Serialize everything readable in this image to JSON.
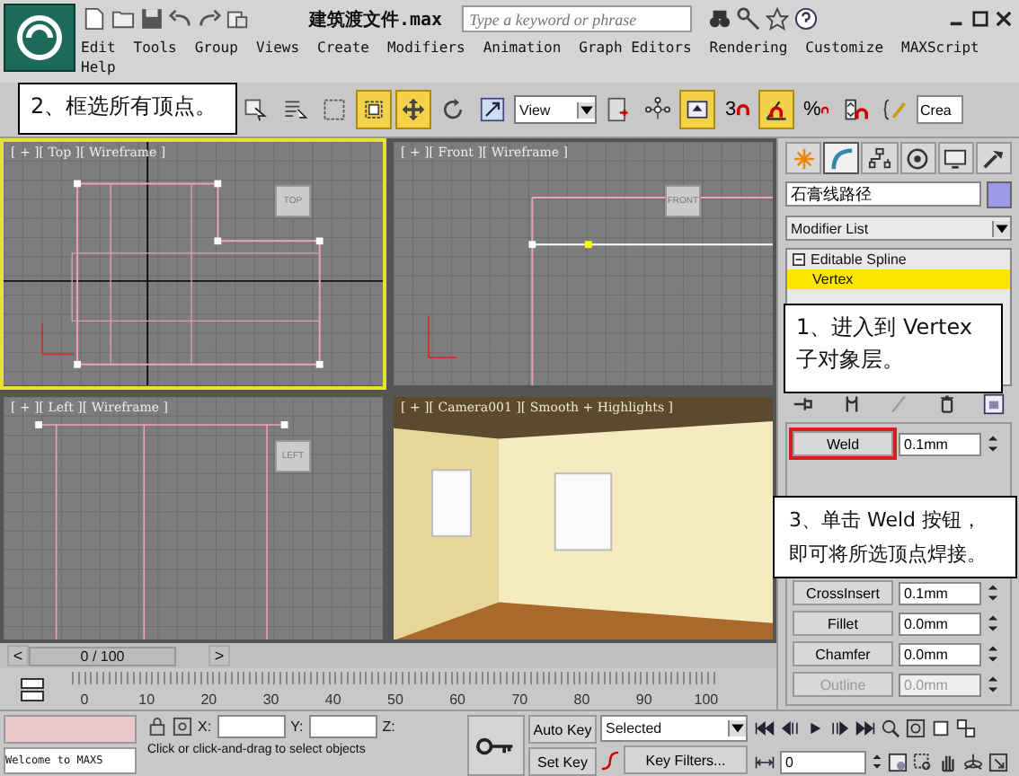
{
  "title_bar": {
    "file_name": "建筑渡文件.max",
    "search": {
      "placeholder": "Type a keyword or phrase"
    }
  },
  "menu": [
    {
      "label": "Edit"
    },
    {
      "label": "Tools"
    },
    {
      "label": "Group"
    },
    {
      "label": "Views"
    },
    {
      "label": "Create"
    },
    {
      "label": "Modifiers"
    },
    {
      "label": "Animation"
    },
    {
      "label": "Graph Editors"
    },
    {
      "label": "Rendering"
    },
    {
      "label": "Customize"
    },
    {
      "label": "MAXScript"
    },
    {
      "label": "Help"
    }
  ],
  "toolbar": {
    "tools": [
      {
        "kind": "select-object",
        "on": false
      },
      {
        "kind": "select-by-name",
        "on": false
      },
      {
        "kind": "region",
        "on": false
      },
      {
        "kind": "window-crossing",
        "on": true
      },
      {
        "kind": "move",
        "on": true
      },
      {
        "kind": "rotate",
        "on": false
      },
      {
        "kind": "scale",
        "on": false
      },
      {
        "kind": "coordinate-dropdown",
        "label": "View"
      },
      {
        "kind": "pivot",
        "on": false
      },
      {
        "kind": "manipulate",
        "on": false
      },
      {
        "kind": "keyboard-toggle",
        "on": true
      },
      {
        "kind": "snap",
        "label": "3",
        "on": false
      },
      {
        "kind": "angle-snap",
        "on": true
      },
      {
        "kind": "percent-snap",
        "label": "%",
        "on": false
      },
      {
        "kind": "spinner-snap",
        "on": false
      },
      {
        "kind": "named-sets",
        "on": false
      },
      {
        "kind": "selection-field",
        "label": "Crea"
      }
    ]
  },
  "viewports": [
    {
      "kind": "top",
      "label": "[ + ][ Top ][ Wireframe ]",
      "cube_label": "TOP",
      "active": true
    },
    {
      "kind": "front",
      "label": "[ + ][ Front ][ Wireframe ]",
      "cube_label": "FRONT",
      "active": false
    },
    {
      "kind": "left",
      "label": "[ + ][ Left ][ Wireframe ]",
      "cube_label": "LEFT",
      "active": false
    },
    {
      "kind": "camera",
      "label": "[ + ][ Camera001 ][ Smooth + Highlights ]",
      "active": false
    }
  ],
  "command_panel": {
    "tabs": [
      {
        "kind": "create",
        "selected": false
      },
      {
        "kind": "modify",
        "selected": true
      },
      {
        "kind": "hierarchy",
        "selected": false
      },
      {
        "kind": "motion",
        "selected": false
      },
      {
        "kind": "display",
        "selected": false
      },
      {
        "kind": "utilities",
        "selected": false
      }
    ],
    "object_name": "石膏线路径",
    "modifier_list": "Modifier List",
    "stack": [
      {
        "label": "Editable Spline",
        "selected": false,
        "children": [
          {
            "label": "Vertex",
            "selected": true
          }
        ]
      }
    ],
    "operations": [
      {
        "label": "Weld",
        "value": "0.1mm",
        "highlighted": true,
        "disabled": false
      },
      {
        "label": "CrossInsert",
        "value": "0.1mm",
        "highlighted": false,
        "disabled": false
      },
      {
        "label": "Fillet",
        "value": "0.0mm",
        "highlighted": false,
        "disabled": false
      },
      {
        "label": "Chamfer",
        "value": "0.0mm",
        "highlighted": false,
        "disabled": false
      },
      {
        "label": "Outline",
        "value": "0.0mm",
        "highlighted": false,
        "disabled": true
      }
    ]
  },
  "time_slider": {
    "label": "0 / 100",
    "level": 0,
    "previous": "<",
    "next": ">"
  },
  "timeline_ticks": [
    "0",
    "10",
    "20",
    "30",
    "40",
    "50",
    "60",
    "70",
    "80",
    "90",
    "100"
  ],
  "status_bar": {
    "listener": "Welcome to MAXS",
    "prompt": "Click or click-and-drag to select objects",
    "x_label": "X:",
    "y_label": "Y:",
    "z_label": "Z:",
    "auto_key": "Auto Key",
    "set_key": "Set Key",
    "key_mode": "Selected",
    "key_filters": "Key Filters...",
    "frame": "0"
  },
  "callouts": [
    {
      "text": "2、框选所有顶点。"
    },
    {
      "text": "1、进入到 Vertex 子对象层。"
    },
    {
      "text": "3、单击 Weld 按钮，即可将所选顶点焊接。"
    }
  ]
}
